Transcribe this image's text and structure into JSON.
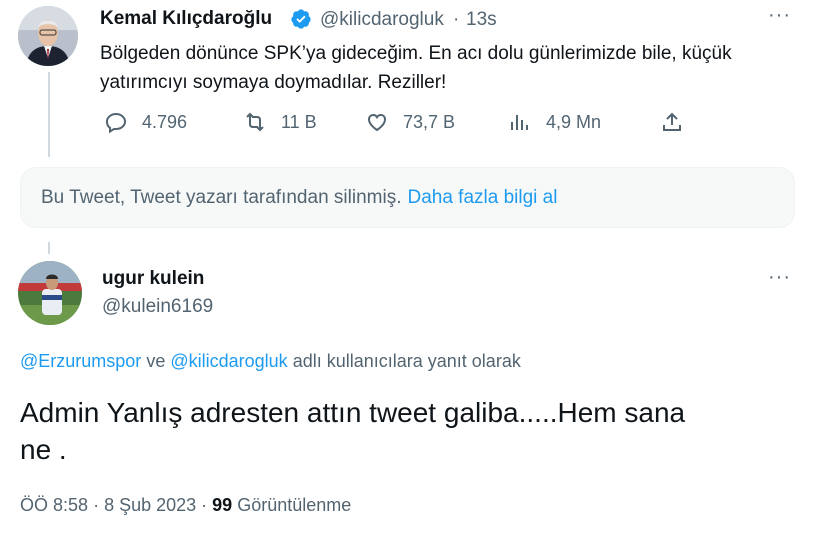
{
  "original_tweet": {
    "author_name": "Kemal Kılıçdaroğlu",
    "handle": "@kilicdarogluk",
    "time": "13s",
    "line1": "Bölgeden dönünce SPK’ya gideceğim. En acı dolu günlerimizde bile, küçük",
    "line2": "yatırımcıyı soymaya doymadılar. Reziller!",
    "actions": {
      "replies": "4.796",
      "retweets": "11 B",
      "likes": "73,7 B",
      "views": "4,9 Mn"
    },
    "verified_color": "#1d9bf0"
  },
  "deleted_notice": {
    "text": "Bu Tweet, Tweet yazarı tarafından silinmiş.",
    "link": "Daha fazla bilgi al"
  },
  "reply": {
    "author_name": "ugur kulein",
    "handle": "@kulein6169",
    "replying_to": {
      "user1": "@Erzurumspor",
      "and": "ve",
      "user2": "@kilicdarogluk",
      "suffix": "adlı kullanıcılara yanıt olarak"
    },
    "body_line1": "Admin Yanlış adresten attın tweet galiba.....Hem sana",
    "body_line2": "ne .",
    "meta": {
      "time": "ÖÖ 8:58",
      "date": "8 Şub 2023",
      "views_count": "99",
      "views_label": "Görüntülenme"
    }
  },
  "icons": {
    "more": "more-horizontal-icon",
    "reply": "reply-icon",
    "retweet": "retweet-icon",
    "like": "heart-icon",
    "views": "views-icon",
    "share": "share-icon",
    "verified": "verified-badge-icon"
  },
  "colors": {
    "accent": "#1d9bf0",
    "secondary_text": "#536471",
    "primary_text": "#0f1419"
  }
}
